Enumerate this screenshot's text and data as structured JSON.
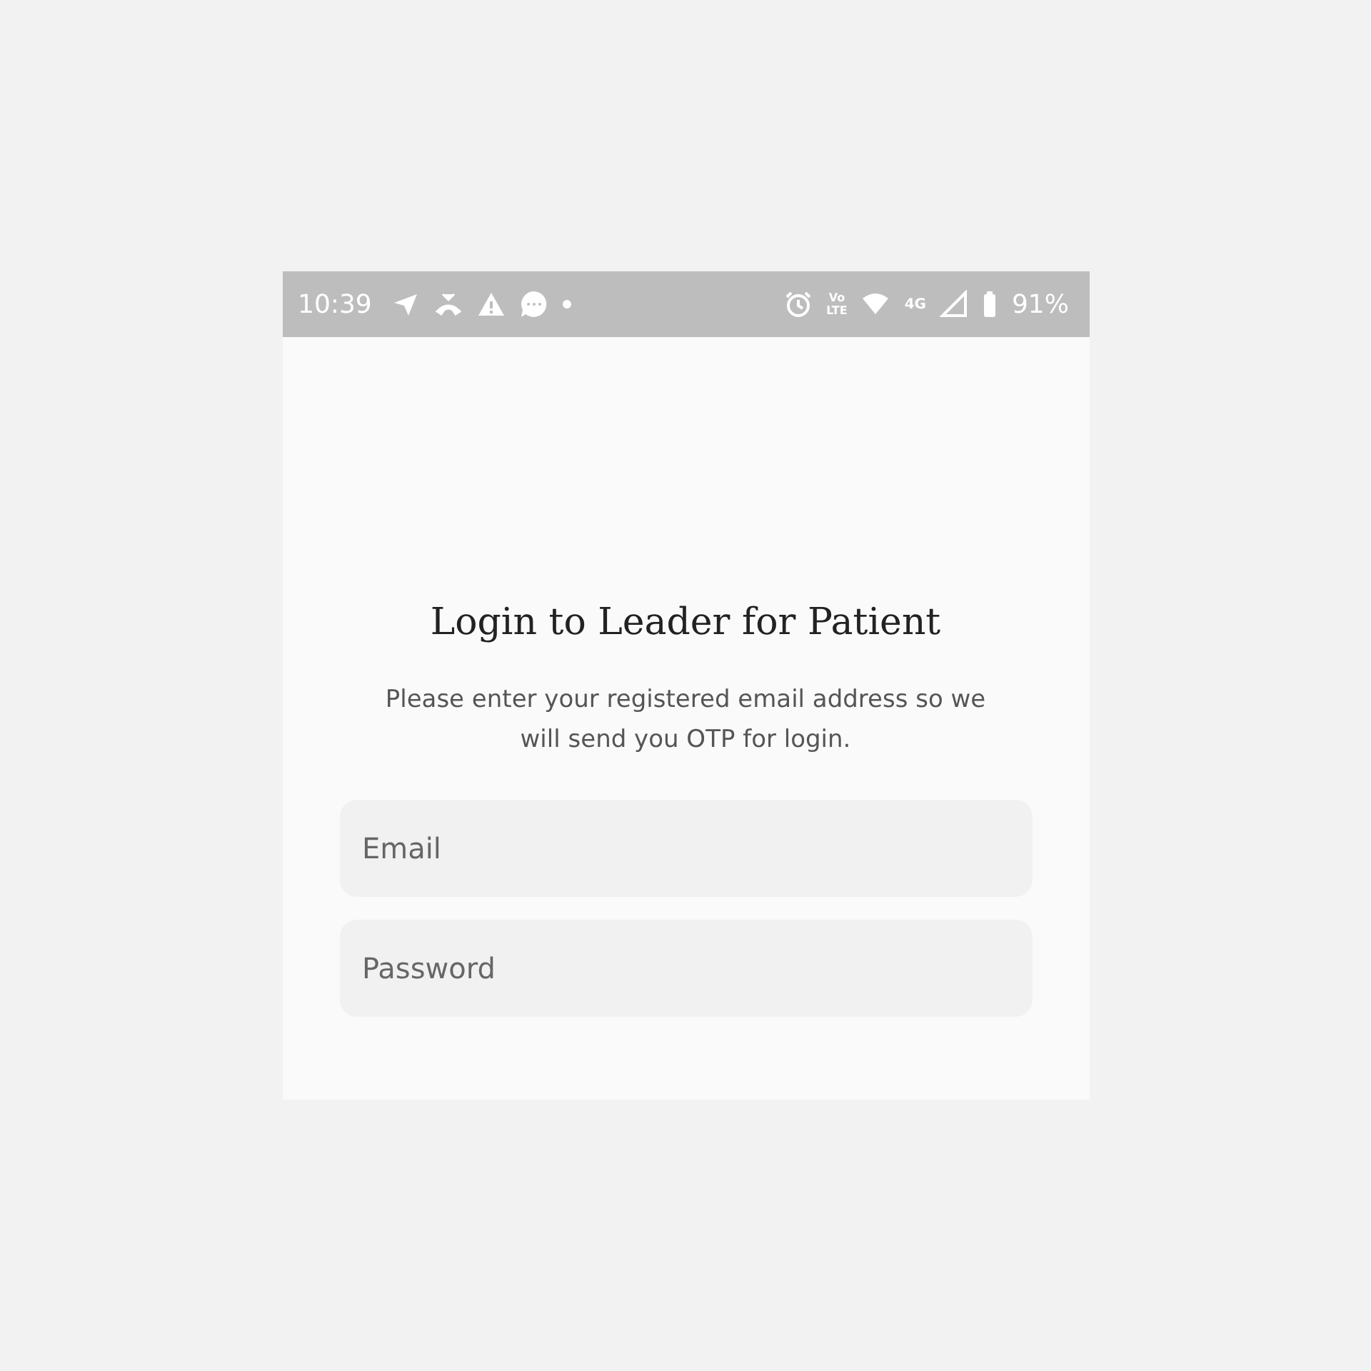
{
  "status_bar": {
    "time": "10:39",
    "network": [
      "Vo",
      "LTE"
    ],
    "signal_label": "4G",
    "battery": "91%"
  },
  "title": "Login to Leader for Patient",
  "subtitle": "Please enter your registered email address so we will send you OTP for login.",
  "fields": [
    {
      "placeholder": "Email"
    },
    {
      "placeholder": "Password"
    }
  ]
}
